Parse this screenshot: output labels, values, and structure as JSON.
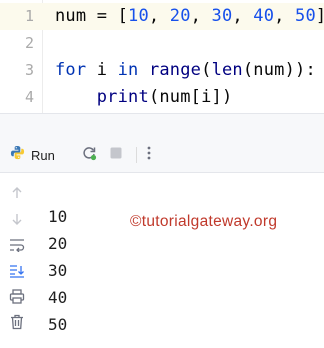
{
  "editor": {
    "lines": [
      {
        "number": "1",
        "parts": {
          "a": "num = [",
          "b": "10",
          "c": ", ",
          "d": "20",
          "e": ", ",
          "f": "30",
          "g": ", ",
          "h": "40",
          "i": ", ",
          "j": "50",
          "k": "]"
        }
      },
      {
        "number": "2"
      },
      {
        "number": "3",
        "parts": {
          "a": "for",
          "b": " i ",
          "c": "in",
          "d": " ",
          "e": "range",
          "f": "(",
          "g": "len",
          "h": "(num)):"
        }
      },
      {
        "number": "4",
        "parts": {
          "a": "    ",
          "b": "print",
          "c": "(num[i])"
        }
      }
    ]
  },
  "run": {
    "tab_label": "Run",
    "icons": {
      "tab": "python-icon",
      "rerun": "rerun-icon",
      "stop": "stop-icon",
      "more": "more-options-icon",
      "side": [
        "arrow-up-icon",
        "arrow-down-icon",
        "soft-wrap-icon",
        "scroll-to-end-icon",
        "print-icon",
        "trash-icon"
      ]
    },
    "output": [
      "10",
      "20",
      "30",
      "40",
      "50"
    ],
    "watermark": "©tutorialgateway.org"
  },
  "colors": {
    "number": "#1750eb",
    "keyword": "#0033b3",
    "builtin": "#000080",
    "current_line": "#fcfaed",
    "watermark": "#c0392b",
    "rerun_green": "#4caf50"
  }
}
